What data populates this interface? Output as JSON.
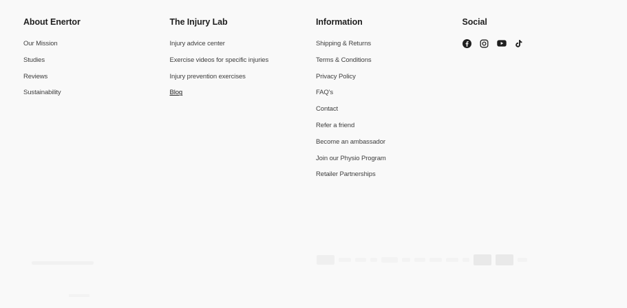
{
  "columns": [
    {
      "title": "About Enertor",
      "links": [
        "Our Mission",
        "Studies",
        "Reviews",
        "Sustainability"
      ]
    },
    {
      "title": "The Injury Lab",
      "links": [
        "Injury advice center",
        "Exercise videos for specific injuries",
        "Injury prevention exercises",
        "Blog"
      ]
    },
    {
      "title": "Information",
      "links": [
        "Shipping & Returns",
        "Terms & Conditions",
        "Privacy Policy",
        "FAQ's",
        "Contact",
        "Refer a friend",
        "Become an ambassador",
        "Join our Physio Program",
        "Retailer Partnerships"
      ]
    }
  ],
  "social": {
    "title": "Social",
    "icons": [
      "facebook-icon",
      "instagram-icon",
      "youtube-icon",
      "tiktok-icon"
    ]
  },
  "colors": {
    "background": "#f9f9f9",
    "heading": "#1f1f1f",
    "link": "#3e3e3e"
  }
}
